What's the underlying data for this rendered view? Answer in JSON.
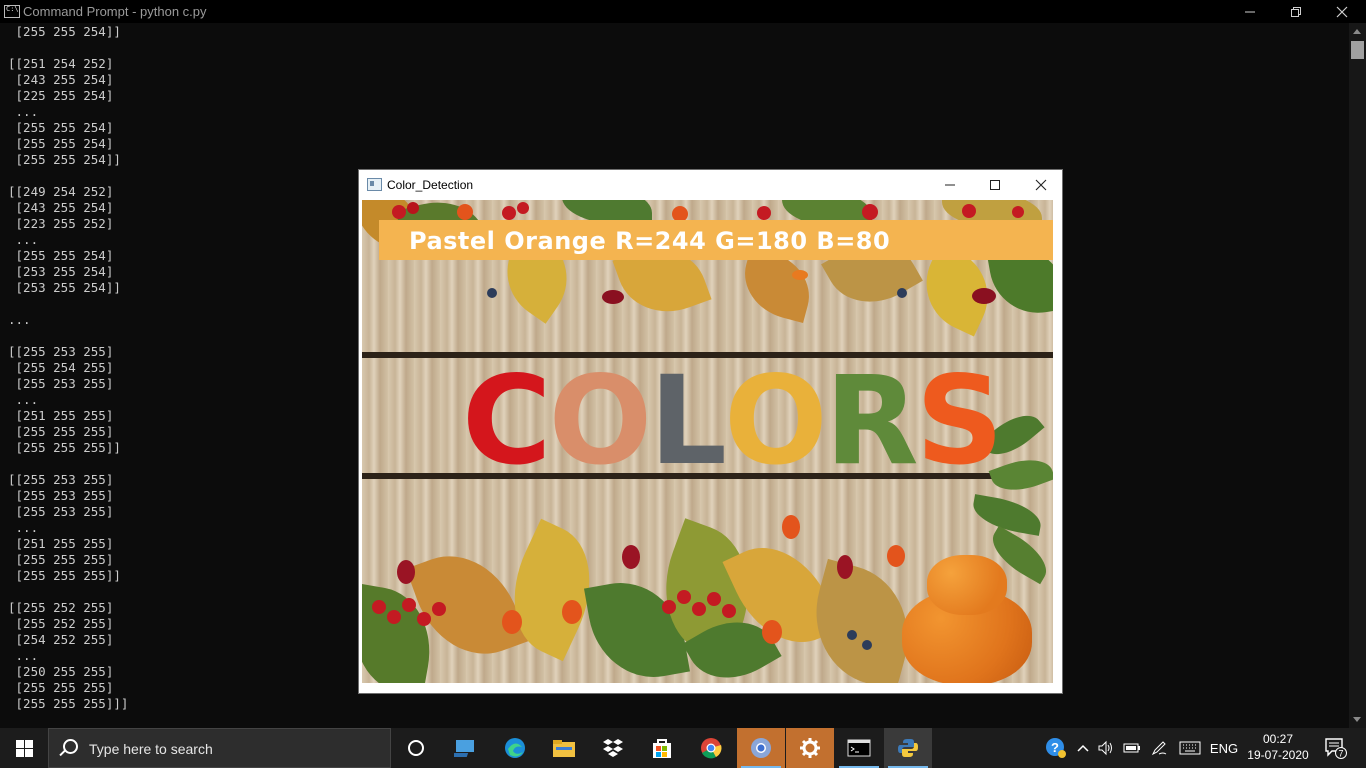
{
  "cmd": {
    "title": "Command Prompt - python  c.py",
    "console_lines": [
      " [255 255 254]]",
      "",
      "[[251 254 252]",
      " [243 255 254]",
      " [225 255 254]",
      " ...",
      " [255 255 254]",
      " [255 255 254]",
      " [255 255 254]]",
      "",
      "[[249 254 252]",
      " [243 255 254]",
      " [223 255 252]",
      " ...",
      " [255 255 254]",
      " [253 255 254]",
      " [253 255 254]]",
      "",
      "...",
      "",
      "[[255 253 255]",
      " [255 254 255]",
      " [255 253 255]",
      " ...",
      " [251 255 255]",
      " [255 255 255]",
      " [255 255 255]]",
      "",
      "[[255 253 255]",
      " [255 253 255]",
      " [255 253 255]",
      " ...",
      " [251 255 255]",
      " [255 255 255]",
      " [255 255 255]]",
      "",
      "[[255 252 255]",
      " [255 252 255]",
      " [254 252 255]",
      " ...",
      " [250 255 255]",
      " [255 255 255]",
      " [255 255 255]]]"
    ]
  },
  "cv_window": {
    "title": "Color_Detection",
    "banner_text": "Pastel Orange R=244 G=180 B=80",
    "banner_color": "#f4b450",
    "word_letters": [
      {
        "ch": "C",
        "color": "#d4161c"
      },
      {
        "ch": "O",
        "color": "#d98e6a"
      },
      {
        "ch": "L",
        "color": "#5e6368"
      },
      {
        "ch": "O",
        "color": "#e9b13a"
      },
      {
        "ch": "R",
        "color": "#5f8a3a"
      },
      {
        "ch": "S",
        "color": "#ee5a1e"
      }
    ]
  },
  "taskbar": {
    "search_placeholder": "Type here to search",
    "apps": [
      "task-view",
      "file-explorer",
      "edge",
      "file-manager",
      "dropbox",
      "store",
      "chrome",
      "chrome-alt",
      "settings",
      "command-prompt",
      "python"
    ],
    "language": "ENG",
    "time": "00:27",
    "date": "19-07-2020",
    "notification_count": "7"
  }
}
